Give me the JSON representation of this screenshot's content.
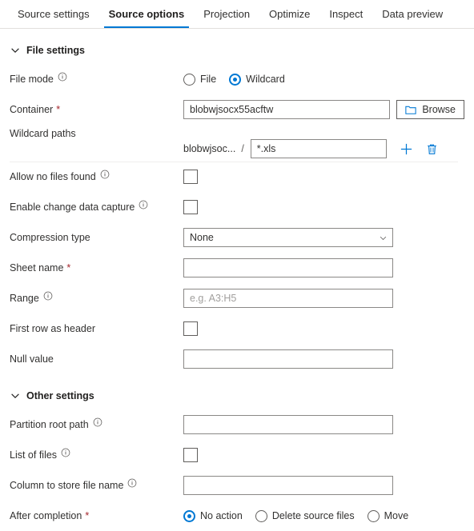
{
  "tabs": [
    {
      "label": "Source settings",
      "active": false
    },
    {
      "label": "Source options",
      "active": true
    },
    {
      "label": "Projection",
      "active": false
    },
    {
      "label": "Optimize",
      "active": false
    },
    {
      "label": "Inspect",
      "active": false
    },
    {
      "label": "Data preview",
      "active": false
    }
  ],
  "accent_color": "#0078d4",
  "required_color": "#a4262c",
  "file_settings": {
    "section_title": "File settings",
    "file_mode": {
      "label": "File mode",
      "options": [
        {
          "label": "File",
          "selected": false
        },
        {
          "label": "Wildcard",
          "selected": true
        }
      ]
    },
    "container": {
      "label": "Container",
      "value": "blobwjsocx55acftw",
      "browse_label": "Browse"
    },
    "wildcard_paths": {
      "label": "Wildcard paths",
      "prefix": "blobwjsoc...",
      "separator": "/",
      "value": "*.xls"
    },
    "allow_no_files_found": {
      "label": "Allow no files found",
      "checked": false
    },
    "enable_change_data_capture": {
      "label": "Enable change data capture",
      "checked": false
    },
    "compression_type": {
      "label": "Compression type",
      "value": "None"
    },
    "sheet_name": {
      "label": "Sheet name",
      "value": ""
    },
    "range": {
      "label": "Range",
      "value": "",
      "placeholder": "e.g. A3:H5"
    },
    "first_row_as_header": {
      "label": "First row as header",
      "checked": false
    },
    "null_value": {
      "label": "Null value",
      "value": ""
    }
  },
  "other_settings": {
    "section_title": "Other settings",
    "partition_root_path": {
      "label": "Partition root path",
      "value": ""
    },
    "list_of_files": {
      "label": "List of files",
      "checked": false
    },
    "column_to_store_file_name": {
      "label": "Column to store file name",
      "value": ""
    },
    "after_completion": {
      "label": "After completion",
      "options": [
        {
          "label": "No action",
          "selected": true
        },
        {
          "label": "Delete source files",
          "selected": false
        },
        {
          "label": "Move",
          "selected": false
        }
      ]
    }
  }
}
